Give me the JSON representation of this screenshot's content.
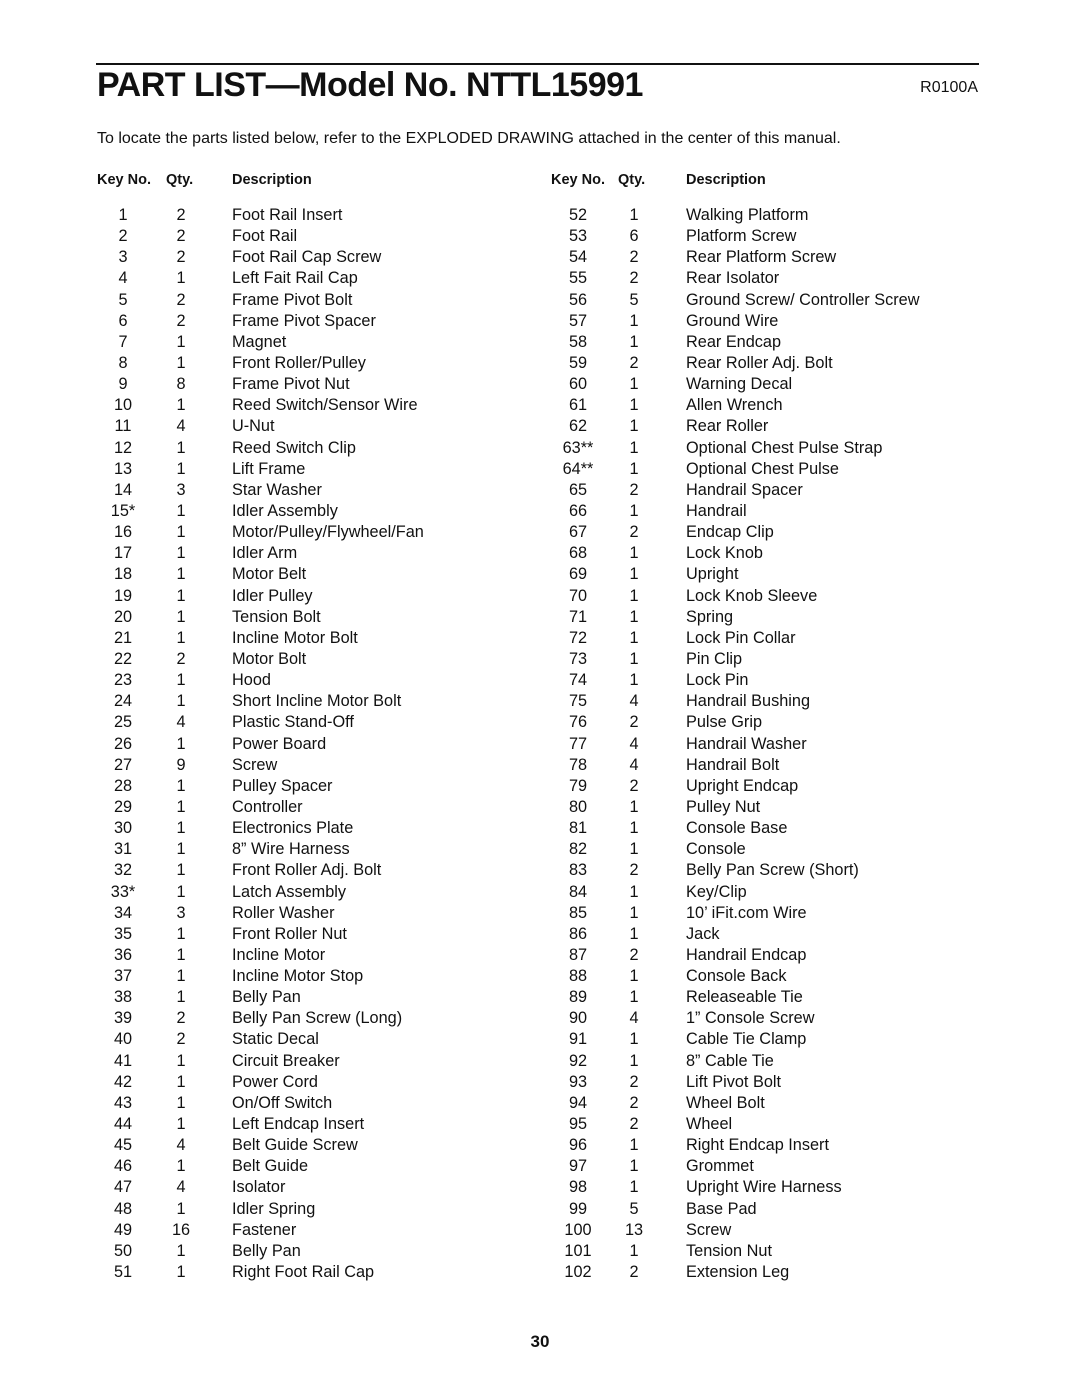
{
  "header": {
    "title": "PART LIST—Model No. NTTL15991",
    "code": "R0100A",
    "intro": "To locate the parts listed below, refer to the EXPLODED DRAWING attached in the center of this manual."
  },
  "columns": {
    "key": "Key No.",
    "qty": "Qty.",
    "desc": "Description"
  },
  "left_parts": [
    {
      "key": "1",
      "qty": "2",
      "desc": "Foot Rail Insert"
    },
    {
      "key": "2",
      "qty": "2",
      "desc": "Foot Rail"
    },
    {
      "key": "3",
      "qty": "2",
      "desc": "Foot Rail Cap Screw"
    },
    {
      "key": "4",
      "qty": "1",
      "desc": "Left Fait Rail Cap"
    },
    {
      "key": "5",
      "qty": "2",
      "desc": "Frame Pivot Bolt"
    },
    {
      "key": "6",
      "qty": "2",
      "desc": "Frame Pivot Spacer"
    },
    {
      "key": "7",
      "qty": "1",
      "desc": "Magnet"
    },
    {
      "key": "8",
      "qty": "1",
      "desc": "Front Roller/Pulley"
    },
    {
      "key": "9",
      "qty": "8",
      "desc": "Frame Pivot Nut"
    },
    {
      "key": "10",
      "qty": "1",
      "desc": "Reed Switch/Sensor Wire"
    },
    {
      "key": "11",
      "qty": "4",
      "desc": "U-Nut"
    },
    {
      "key": "12",
      "qty": "1",
      "desc": "Reed Switch Clip"
    },
    {
      "key": "13",
      "qty": "1",
      "desc": "Lift Frame"
    },
    {
      "key": "14",
      "qty": "3",
      "desc": "Star Washer"
    },
    {
      "key": "15*",
      "qty": "1",
      "desc": "Idler Assembly"
    },
    {
      "key": "16",
      "qty": "1",
      "desc": "Motor/Pulley/Flywheel/Fan"
    },
    {
      "key": "17",
      "qty": "1",
      "desc": "Idler Arm"
    },
    {
      "key": "18",
      "qty": "1",
      "desc": "Motor Belt"
    },
    {
      "key": "19",
      "qty": "1",
      "desc": "Idler Pulley"
    },
    {
      "key": "20",
      "qty": "1",
      "desc": "Tension Bolt"
    },
    {
      "key": "21",
      "qty": "1",
      "desc": "Incline Motor Bolt"
    },
    {
      "key": "22",
      "qty": "2",
      "desc": "Motor Bolt"
    },
    {
      "key": "23",
      "qty": "1",
      "desc": "Hood"
    },
    {
      "key": "24",
      "qty": "1",
      "desc": "Short Incline Motor Bolt"
    },
    {
      "key": "25",
      "qty": "4",
      "desc": "Plastic Stand-Off"
    },
    {
      "key": "26",
      "qty": "1",
      "desc": "Power Board"
    },
    {
      "key": "27",
      "qty": "9",
      "desc": "Screw"
    },
    {
      "key": "28",
      "qty": "1",
      "desc": "Pulley Spacer"
    },
    {
      "key": "29",
      "qty": "1",
      "desc": "Controller"
    },
    {
      "key": "30",
      "qty": "1",
      "desc": "Electronics Plate"
    },
    {
      "key": "31",
      "qty": "1",
      "desc": "8” Wire Harness"
    },
    {
      "key": "32",
      "qty": "1",
      "desc": "Front Roller Adj. Bolt"
    },
    {
      "key": "33*",
      "qty": "1",
      "desc": "Latch Assembly"
    },
    {
      "key": "34",
      "qty": "3",
      "desc": "Roller Washer"
    },
    {
      "key": "35",
      "qty": "1",
      "desc": "Front Roller Nut"
    },
    {
      "key": "36",
      "qty": "1",
      "desc": "Incline Motor"
    },
    {
      "key": "37",
      "qty": "1",
      "desc": "Incline Motor Stop"
    },
    {
      "key": "38",
      "qty": "1",
      "desc": "Belly Pan"
    },
    {
      "key": "39",
      "qty": "2",
      "desc": "Belly Pan Screw (Long)"
    },
    {
      "key": "40",
      "qty": "2",
      "desc": "Static Decal"
    },
    {
      "key": "41",
      "qty": "1",
      "desc": "Circuit Breaker"
    },
    {
      "key": "42",
      "qty": "1",
      "desc": "Power Cord"
    },
    {
      "key": "43",
      "qty": "1",
      "desc": "On/Off Switch"
    },
    {
      "key": "44",
      "qty": "1",
      "desc": "Left Endcap Insert"
    },
    {
      "key": "45",
      "qty": "4",
      "desc": "Belt Guide Screw"
    },
    {
      "key": "46",
      "qty": "1",
      "desc": "Belt Guide"
    },
    {
      "key": "47",
      "qty": "4",
      "desc": "Isolator"
    },
    {
      "key": "48",
      "qty": "1",
      "desc": "Idler Spring"
    },
    {
      "key": "49",
      "qty": "16",
      "desc": "Fastener"
    },
    {
      "key": "50",
      "qty": "1",
      "desc": "Belly Pan"
    },
    {
      "key": "51",
      "qty": "1",
      "desc": "Right Foot Rail Cap"
    }
  ],
  "right_parts": [
    {
      "key": "52",
      "qty": "1",
      "desc": "Walking Platform"
    },
    {
      "key": "53",
      "qty": "6",
      "desc": "Platform Screw"
    },
    {
      "key": "54",
      "qty": "2",
      "desc": "Rear Platform Screw"
    },
    {
      "key": "55",
      "qty": "2",
      "desc": "Rear Isolator"
    },
    {
      "key": "56",
      "qty": "5",
      "desc": "Ground Screw/ Controller Screw"
    },
    {
      "key": "57",
      "qty": "1",
      "desc": "Ground Wire"
    },
    {
      "key": "58",
      "qty": "1",
      "desc": "Rear Endcap"
    },
    {
      "key": "59",
      "qty": "2",
      "desc": "Rear Roller Adj. Bolt"
    },
    {
      "key": "60",
      "qty": "1",
      "desc": "Warning Decal"
    },
    {
      "key": "61",
      "qty": "1",
      "desc": "Allen Wrench"
    },
    {
      "key": "62",
      "qty": "1",
      "desc": "Rear Roller"
    },
    {
      "key": "63**",
      "qty": "1",
      "desc": "Optional Chest Pulse Strap"
    },
    {
      "key": "64**",
      "qty": "1",
      "desc": "Optional Chest Pulse"
    },
    {
      "key": "65",
      "qty": "2",
      "desc": "Handrail Spacer"
    },
    {
      "key": "66",
      "qty": "1",
      "desc": "Handrail"
    },
    {
      "key": "67",
      "qty": "2",
      "desc": "Endcap Clip"
    },
    {
      "key": "68",
      "qty": "1",
      "desc": "Lock Knob"
    },
    {
      "key": "69",
      "qty": "1",
      "desc": "Upright"
    },
    {
      "key": "70",
      "qty": "1",
      "desc": "Lock Knob Sleeve"
    },
    {
      "key": "71",
      "qty": "1",
      "desc": "Spring"
    },
    {
      "key": "72",
      "qty": "1",
      "desc": "Lock Pin Collar"
    },
    {
      "key": "73",
      "qty": "1",
      "desc": "Pin Clip"
    },
    {
      "key": "74",
      "qty": "1",
      "desc": "Lock Pin"
    },
    {
      "key": "75",
      "qty": "4",
      "desc": "Handrail Bushing"
    },
    {
      "key": "76",
      "qty": "2",
      "desc": "Pulse Grip"
    },
    {
      "key": "77",
      "qty": "4",
      "desc": "Handrail Washer"
    },
    {
      "key": "78",
      "qty": "4",
      "desc": "Handrail Bolt"
    },
    {
      "key": "79",
      "qty": "2",
      "desc": "Upright Endcap"
    },
    {
      "key": "80",
      "qty": "1",
      "desc": "Pulley Nut"
    },
    {
      "key": "81",
      "qty": "1",
      "desc": "Console Base"
    },
    {
      "key": "82",
      "qty": "1",
      "desc": "Console"
    },
    {
      "key": "83",
      "qty": "2",
      "desc": "Belly Pan Screw (Short)"
    },
    {
      "key": "84",
      "qty": "1",
      "desc": "Key/Clip"
    },
    {
      "key": "85",
      "qty": "1",
      "desc": "10’ iFit.com Wire"
    },
    {
      "key": "86",
      "qty": "1",
      "desc": "Jack"
    },
    {
      "key": "87",
      "qty": "2",
      "desc": "Handrail Endcap"
    },
    {
      "key": "88",
      "qty": "1",
      "desc": "Console Back"
    },
    {
      "key": "89",
      "qty": "1",
      "desc": "Releaseable Tie"
    },
    {
      "key": "90",
      "qty": "4",
      "desc": "1” Console Screw"
    },
    {
      "key": "91",
      "qty": "1",
      "desc": "Cable Tie Clamp"
    },
    {
      "key": "92",
      "qty": "1",
      "desc": "8” Cable Tie"
    },
    {
      "key": "93",
      "qty": "2",
      "desc": "Lift Pivot Bolt"
    },
    {
      "key": "94",
      "qty": "2",
      "desc": "Wheel Bolt"
    },
    {
      "key": "95",
      "qty": "2",
      "desc": "Wheel"
    },
    {
      "key": "96",
      "qty": "1",
      "desc": "Right Endcap Insert"
    },
    {
      "key": "97",
      "qty": "1",
      "desc": "Grommet"
    },
    {
      "key": "98",
      "qty": "1",
      "desc": "Upright Wire Harness"
    },
    {
      "key": "99",
      "qty": "5",
      "desc": "Base Pad"
    },
    {
      "key": "100",
      "qty": "13",
      "desc": "Screw"
    },
    {
      "key": "101",
      "qty": "1",
      "desc": "Tension Nut"
    },
    {
      "key": "102",
      "qty": "2",
      "desc": "Extension Leg"
    }
  ],
  "footer": {
    "page_number": "30"
  }
}
